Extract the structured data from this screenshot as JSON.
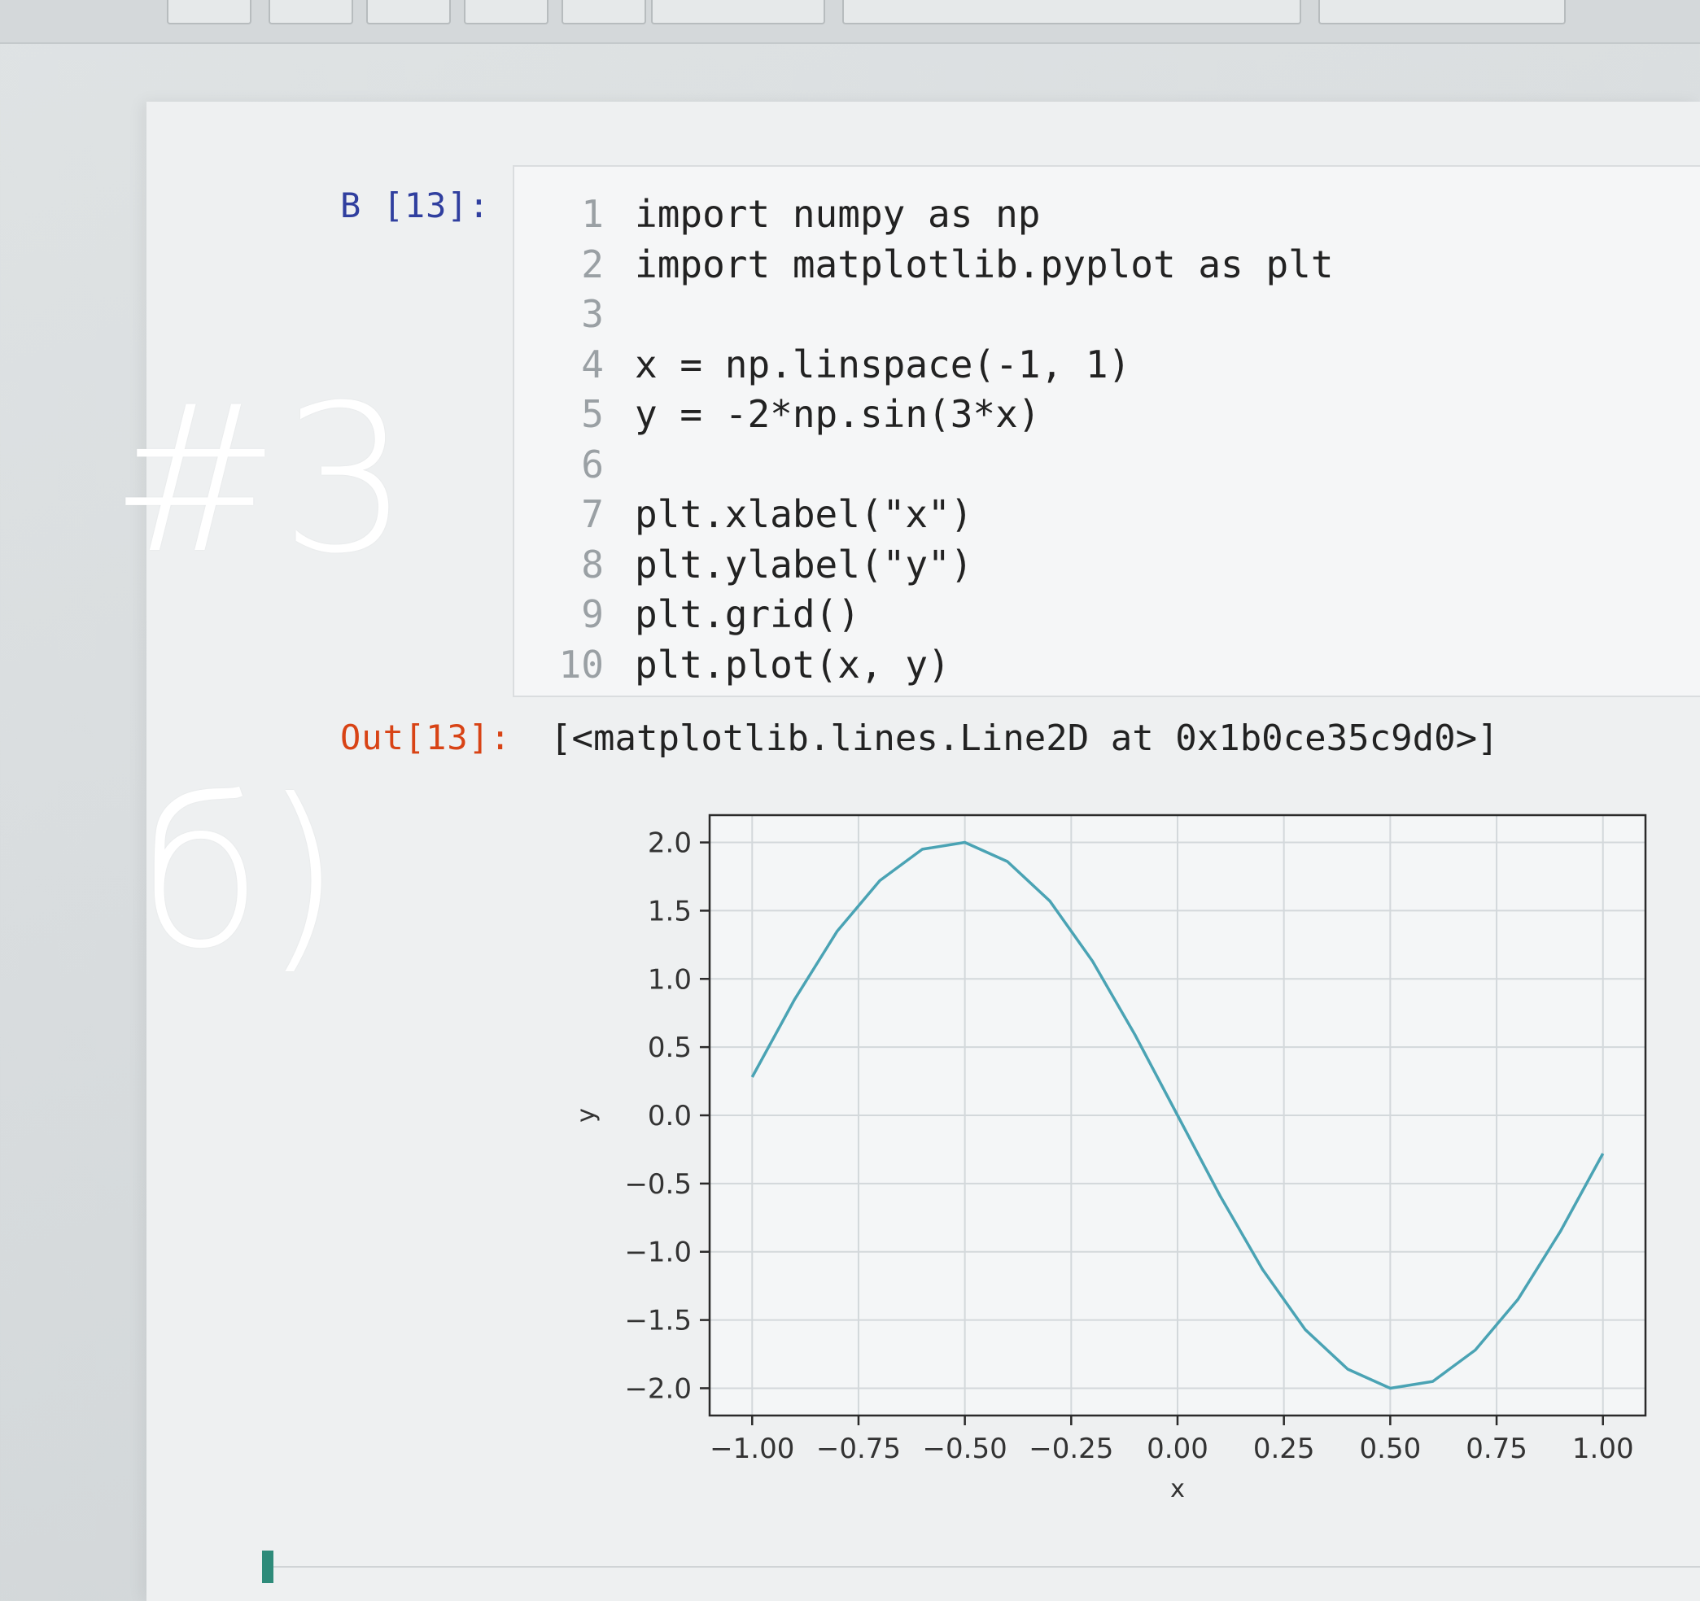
{
  "annotations": {
    "problem_number": "#3",
    "part_label": "б)"
  },
  "cell": {
    "in_prompt": "B [13]:",
    "out_prompt": "Out[13]:",
    "output_text": "[<matplotlib.lines.Line2D at 0x1b0ce35c9d0>]",
    "lines": [
      {
        "num": "1",
        "code": "import numpy as np"
      },
      {
        "num": "2",
        "code": "import matplotlib.pyplot as plt"
      },
      {
        "num": "3",
        "code": ""
      },
      {
        "num": "4",
        "code": "x = np.linspace(-1, 1)"
      },
      {
        "num": "5",
        "code": "y = -2*np.sin(3*x)"
      },
      {
        "num": "6",
        "code": ""
      },
      {
        "num": "7",
        "code": "plt.xlabel(\"x\")"
      },
      {
        "num": "8",
        "code": "plt.ylabel(\"y\")"
      },
      {
        "num": "9",
        "code": "plt.grid()"
      },
      {
        "num": "10",
        "code": "plt.plot(x, y)"
      }
    ]
  },
  "chart_data": {
    "type": "line",
    "xlabel": "x",
    "ylabel": "y",
    "grid": true,
    "xlim": [
      -1.1,
      1.1
    ],
    "ylim": [
      -2.2,
      2.2
    ],
    "xticks": [
      "-1.00",
      "-0.75",
      "-0.50",
      "-0.25",
      "0.00",
      "0.25",
      "0.50",
      "0.75",
      "1.00"
    ],
    "xtick_values": [
      -1.0,
      -0.75,
      -0.5,
      -0.25,
      0.0,
      0.25,
      0.5,
      0.75,
      1.0
    ],
    "yticks": [
      "-2.0",
      "-1.5",
      "-1.0",
      "-0.5",
      "0.0",
      "0.5",
      "1.0",
      "1.5",
      "2.0"
    ],
    "ytick_values": [
      -2.0,
      -1.5,
      -1.0,
      -0.5,
      0.0,
      0.5,
      1.0,
      1.5,
      2.0
    ],
    "series": [
      {
        "color": "#4aa3b4",
        "x": [
          -1.0,
          -0.9,
          -0.8,
          -0.7,
          -0.6,
          -0.5,
          -0.4,
          -0.3,
          -0.2,
          -0.1,
          0.0,
          0.1,
          0.2,
          0.3,
          0.4,
          0.5,
          0.6,
          0.7,
          0.8,
          0.9,
          1.0
        ],
        "y": [
          0.28,
          0.85,
          1.35,
          1.72,
          1.95,
          2.0,
          1.86,
          1.57,
          1.13,
          0.59,
          0.0,
          -0.59,
          -1.13,
          -1.57,
          -1.86,
          -2.0,
          -1.95,
          -1.72,
          -1.35,
          -0.85,
          -0.28
        ]
      }
    ]
  }
}
